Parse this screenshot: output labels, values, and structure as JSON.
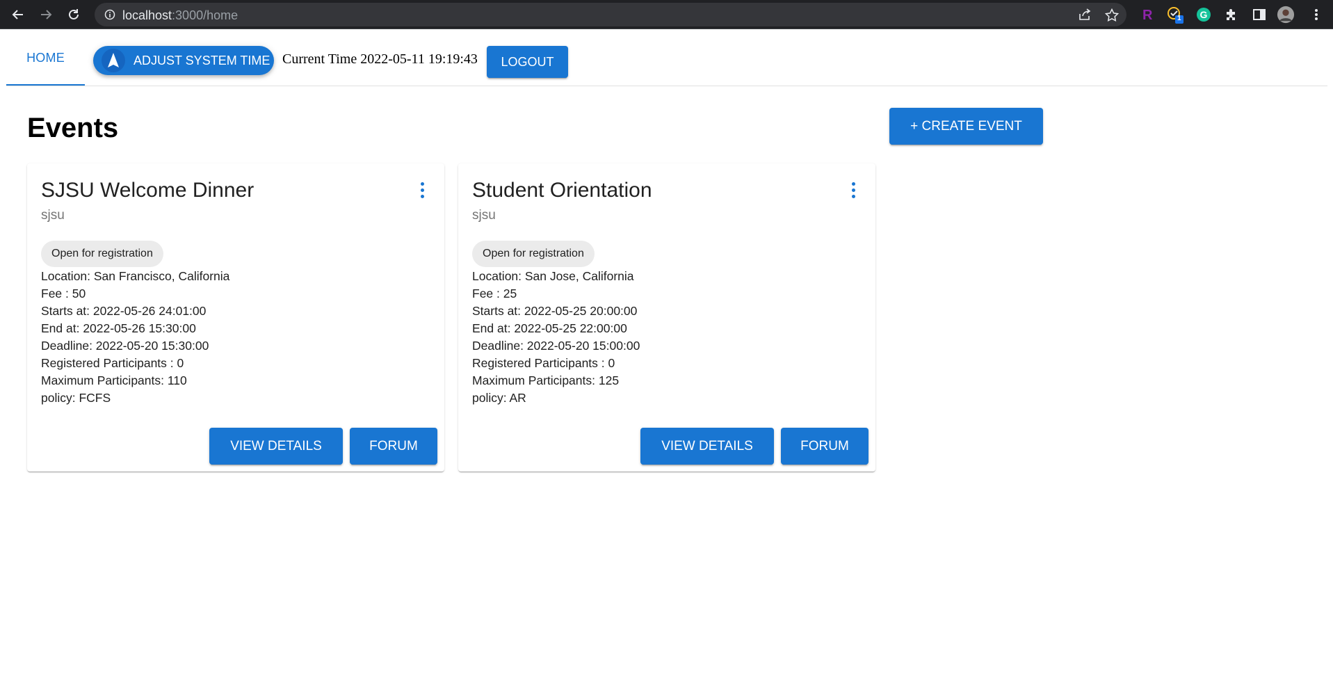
{
  "browser": {
    "url_host": "localhost",
    "url_path": ":3000/home",
    "extension_badge": "1"
  },
  "header": {
    "tab_home": "HOME",
    "adjust_label": "ADJUST SYSTEM TIME",
    "current_time": "Current Time 2022-05-11 19:19:43",
    "logout_label": "LOGOUT"
  },
  "page": {
    "title": "Events",
    "create_label": "+ CREATE EVENT"
  },
  "colors": {
    "primary": "#1976d2",
    "chrome": "#202124",
    "chip": "#ebebeb"
  },
  "events": [
    {
      "title": "SJSU Welcome Dinner",
      "org": "sjsu",
      "status": "Open for registration",
      "location": "Location: San Francisco, California",
      "fee": "Fee : 50",
      "starts": "Starts at: 2022-05-26 24:01:00",
      "ends": "End at: 2022-05-26 15:30:00",
      "deadline": "Deadline: 2022-05-20 15:30:00",
      "registered": "Registered Participants : 0",
      "maximum": "Maximum Participants: 110",
      "policy": "policy: FCFS",
      "view_label": "VIEW DETAILS",
      "forum_label": "FORUM"
    },
    {
      "title": "Student Orientation",
      "org": "sjsu",
      "status": "Open for registration",
      "location": "Location: San Jose, California",
      "fee": "Fee : 25",
      "starts": "Starts at: 2022-05-25 20:00:00",
      "ends": "End at: 2022-05-25 22:00:00",
      "deadline": "Deadline: 2022-05-20 15:00:00",
      "registered": "Registered Participants : 0",
      "maximum": "Maximum Participants: 125",
      "policy": "policy: AR",
      "view_label": "VIEW DETAILS",
      "forum_label": "FORUM"
    }
  ]
}
